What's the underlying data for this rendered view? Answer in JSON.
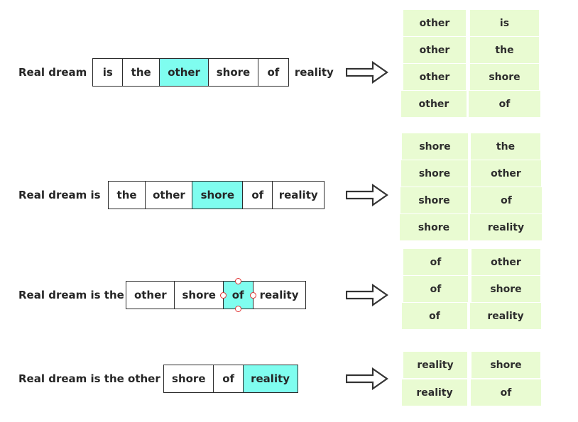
{
  "colors": {
    "highlight": "#7ffdef",
    "cell_bg": "#e9fbd2",
    "box_border": "#2c2c2c",
    "handle_border": "#e03030",
    "text": "#262626",
    "background": "#ffffff"
  },
  "icons": {
    "arrow": "right-block-arrow-icon"
  },
  "rows": [
    {
      "id": "row-1",
      "prefix": "Real  dream",
      "suffix": "reality",
      "tokens": [
        {
          "text": "is",
          "highlighted": false
        },
        {
          "text": "the",
          "highlighted": false
        },
        {
          "text": "other",
          "highlighted": true
        },
        {
          "text": "shore",
          "highlighted": false
        },
        {
          "text": "of",
          "highlighted": false
        }
      ],
      "pairs": [
        {
          "left": "other",
          "right": "is"
        },
        {
          "left": "other",
          "right": "the"
        },
        {
          "left": "other",
          "right": "shore"
        },
        {
          "left": "other",
          "right": "of"
        }
      ]
    },
    {
      "id": "row-2",
      "prefix": "Real  dream   is",
      "suffix": "",
      "tokens": [
        {
          "text": "the",
          "highlighted": false
        },
        {
          "text": "other",
          "highlighted": false
        },
        {
          "text": "shore",
          "highlighted": true
        },
        {
          "text": "of",
          "highlighted": false
        },
        {
          "text": "reality",
          "highlighted": false
        }
      ],
      "pairs": [
        {
          "left": "shore",
          "right": "the"
        },
        {
          "left": "shore",
          "right": "other"
        },
        {
          "left": "shore",
          "right": "of"
        },
        {
          "left": "shore",
          "right": "reality"
        }
      ]
    },
    {
      "id": "row-3",
      "prefix": "Real  dream  is  the",
      "suffix": "",
      "tokens": [
        {
          "text": "other",
          "highlighted": false
        },
        {
          "text": "shore",
          "highlighted": false
        },
        {
          "text": "of",
          "highlighted": true
        },
        {
          "text": "reality",
          "highlighted": false
        }
      ],
      "pairs": [
        {
          "left": "of",
          "right": "other"
        },
        {
          "left": "of",
          "right": "shore"
        },
        {
          "left": "of",
          "right": "reality"
        }
      ]
    },
    {
      "id": "row-4",
      "prefix": "Real dream is the other",
      "suffix": "",
      "tokens": [
        {
          "text": "shore",
          "highlighted": false
        },
        {
          "text": "of",
          "highlighted": false
        },
        {
          "text": "reality",
          "highlighted": true
        }
      ],
      "pairs": [
        {
          "left": "reality",
          "right": "shore"
        },
        {
          "left": "reality",
          "right": "of"
        }
      ]
    }
  ]
}
